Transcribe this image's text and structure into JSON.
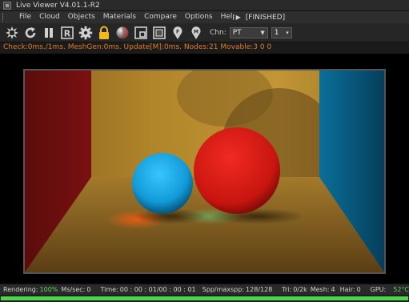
{
  "window": {
    "title": "Live Viewer V4.01.1-R2"
  },
  "menu": {
    "items": [
      "File",
      "Cloud",
      "Objects",
      "Materials",
      "Compare",
      "Options",
      "Help"
    ],
    "overflow_icon": "chevron-right-icon",
    "status": "[FINISHED]"
  },
  "toolbar": {
    "buttons": [
      {
        "name": "aperture-icon"
      },
      {
        "name": "restart-icon"
      },
      {
        "name": "pause-icon"
      },
      {
        "name": "r-icon"
      },
      {
        "name": "gear-icon"
      },
      {
        "name": "lock-icon"
      },
      {
        "name": "material-ball-icon"
      },
      {
        "name": "region-icon"
      },
      {
        "name": "film-region-icon"
      },
      {
        "name": "focus-pin-icon"
      },
      {
        "name": "picker-pin-icon"
      }
    ],
    "channel_label": "Chn:",
    "channel_value": "PT",
    "spinner_value": "1"
  },
  "stats": {
    "text": "Check:0ms./1ms. MeshGen:0ms. Update[M]:0ms. Nodes:21 Movable:3  0 0"
  },
  "colors": {
    "accent_orange": "#e07b24",
    "progress_green": "#4cd64c",
    "lock_yellow": "#f2b81e"
  },
  "statusbar": {
    "rendering_label": "Rendering:",
    "rendering_value": "100%",
    "ms_label": "Ms/sec:",
    "ms_value": "0",
    "time_label": "Time:",
    "time_value": "00 : 00 : 01/00 : 00 : 01",
    "spp_label": "Spp/maxspp:",
    "spp_value": "128/128",
    "tri_label": "Tri:",
    "tri_value": "0/2k",
    "mesh_label": "Mesh:",
    "mesh_value": "4",
    "hair_label": "Hair:",
    "hair_value": "0",
    "gpu_label": "GPU:",
    "gpu_temp": "52°C"
  },
  "progress": {
    "fraction": 1.0
  }
}
